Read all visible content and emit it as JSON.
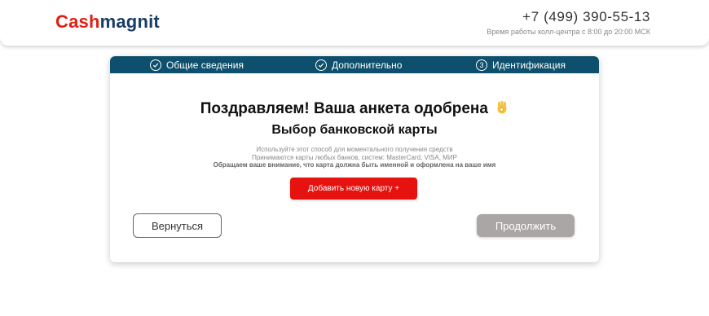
{
  "header": {
    "logo_part1": "Cash",
    "logo_part2": "magnit",
    "phone": "+7 (499) 390-55-13",
    "hours": "Время работы колл-центра с 8:00 до 20:00 МСК"
  },
  "steps": [
    {
      "label": "Общие сведения",
      "icon": "check-icon"
    },
    {
      "label": "Дополнительно",
      "icon": "check-icon"
    },
    {
      "label": "Идентификация",
      "number": "3"
    }
  ],
  "main": {
    "title": "Поздравляем! Ваша анкета одобрена",
    "subtitle": "Выбор банковской карты",
    "info_line1": "Используйте этот способ для моментального получения средств",
    "info_line2": "Принимаются карты любых банков, систем: MasterCard, VISA, МИР",
    "info_line3": "Обращаем ваше внимание, что карта должна быть именной и оформлена на ваше имя",
    "add_card_label": "Добавить новую карту +",
    "back_label": "Вернуться",
    "next_label": "Продолжить"
  },
  "colors": {
    "brand_red": "#e11e14",
    "brand_navy": "#1a3d66",
    "steps_bg": "#0d4f6c",
    "button_red": "#e5120f",
    "button_disabled": "#aaa6a6"
  }
}
